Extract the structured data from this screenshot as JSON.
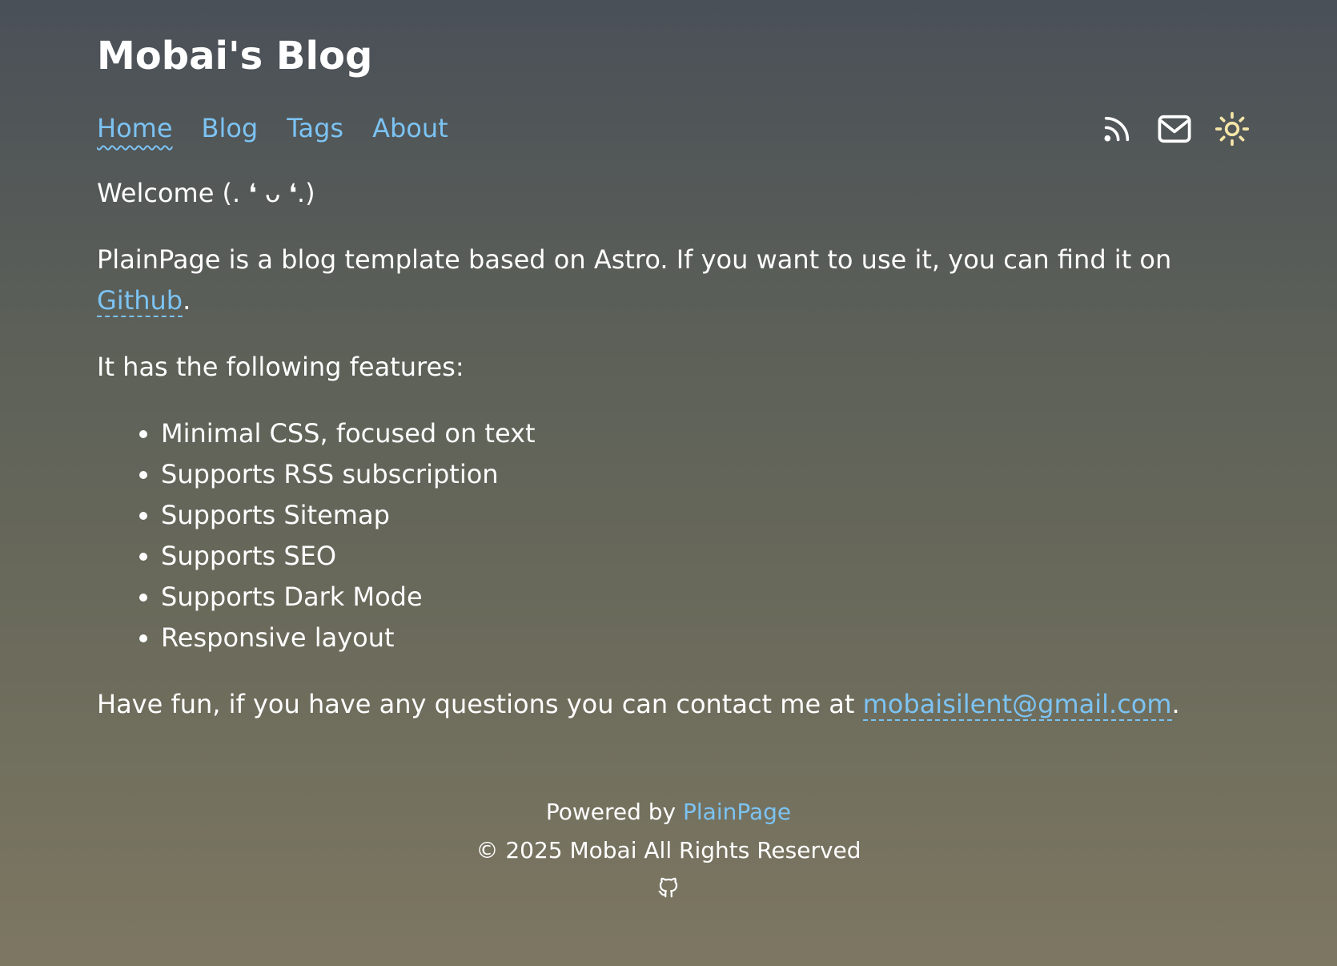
{
  "header": {
    "site_title": "Mobai's Blog"
  },
  "nav": {
    "items": [
      {
        "label": "Home",
        "active": true
      },
      {
        "label": "Blog"
      },
      {
        "label": "Tags"
      },
      {
        "label": "About"
      }
    ],
    "icons": [
      "rss-icon",
      "mail-icon",
      "sun-icon"
    ]
  },
  "main": {
    "welcome": "Welcome (. ❛ ᴗ ❛.)",
    "intro_text": "PlainPage is a blog template based on Astro. If you want to use it, you can find it on ",
    "intro_link": "Github",
    "intro_end": ".",
    "features_intro": "It has the following features:",
    "features": [
      "Minimal CSS, focused on text",
      "Supports RSS subscription",
      "Supports Sitemap",
      "Supports SEO",
      "Supports Dark Mode",
      "Responsive layout"
    ],
    "contact_text": "Have fun, if you have any questions you can contact me at ",
    "contact_email": "mobaisilent@gmail.com",
    "contact_end": "."
  },
  "footer": {
    "powered_prefix": "Powered by ",
    "powered_link": "PlainPage",
    "copyright": "© 2025 Mobai All Rights Reserved",
    "icon": "github-icon"
  },
  "colors": {
    "link": "#7cc3f3",
    "text": "#ffffff",
    "sun": "#f5e6a8"
  }
}
